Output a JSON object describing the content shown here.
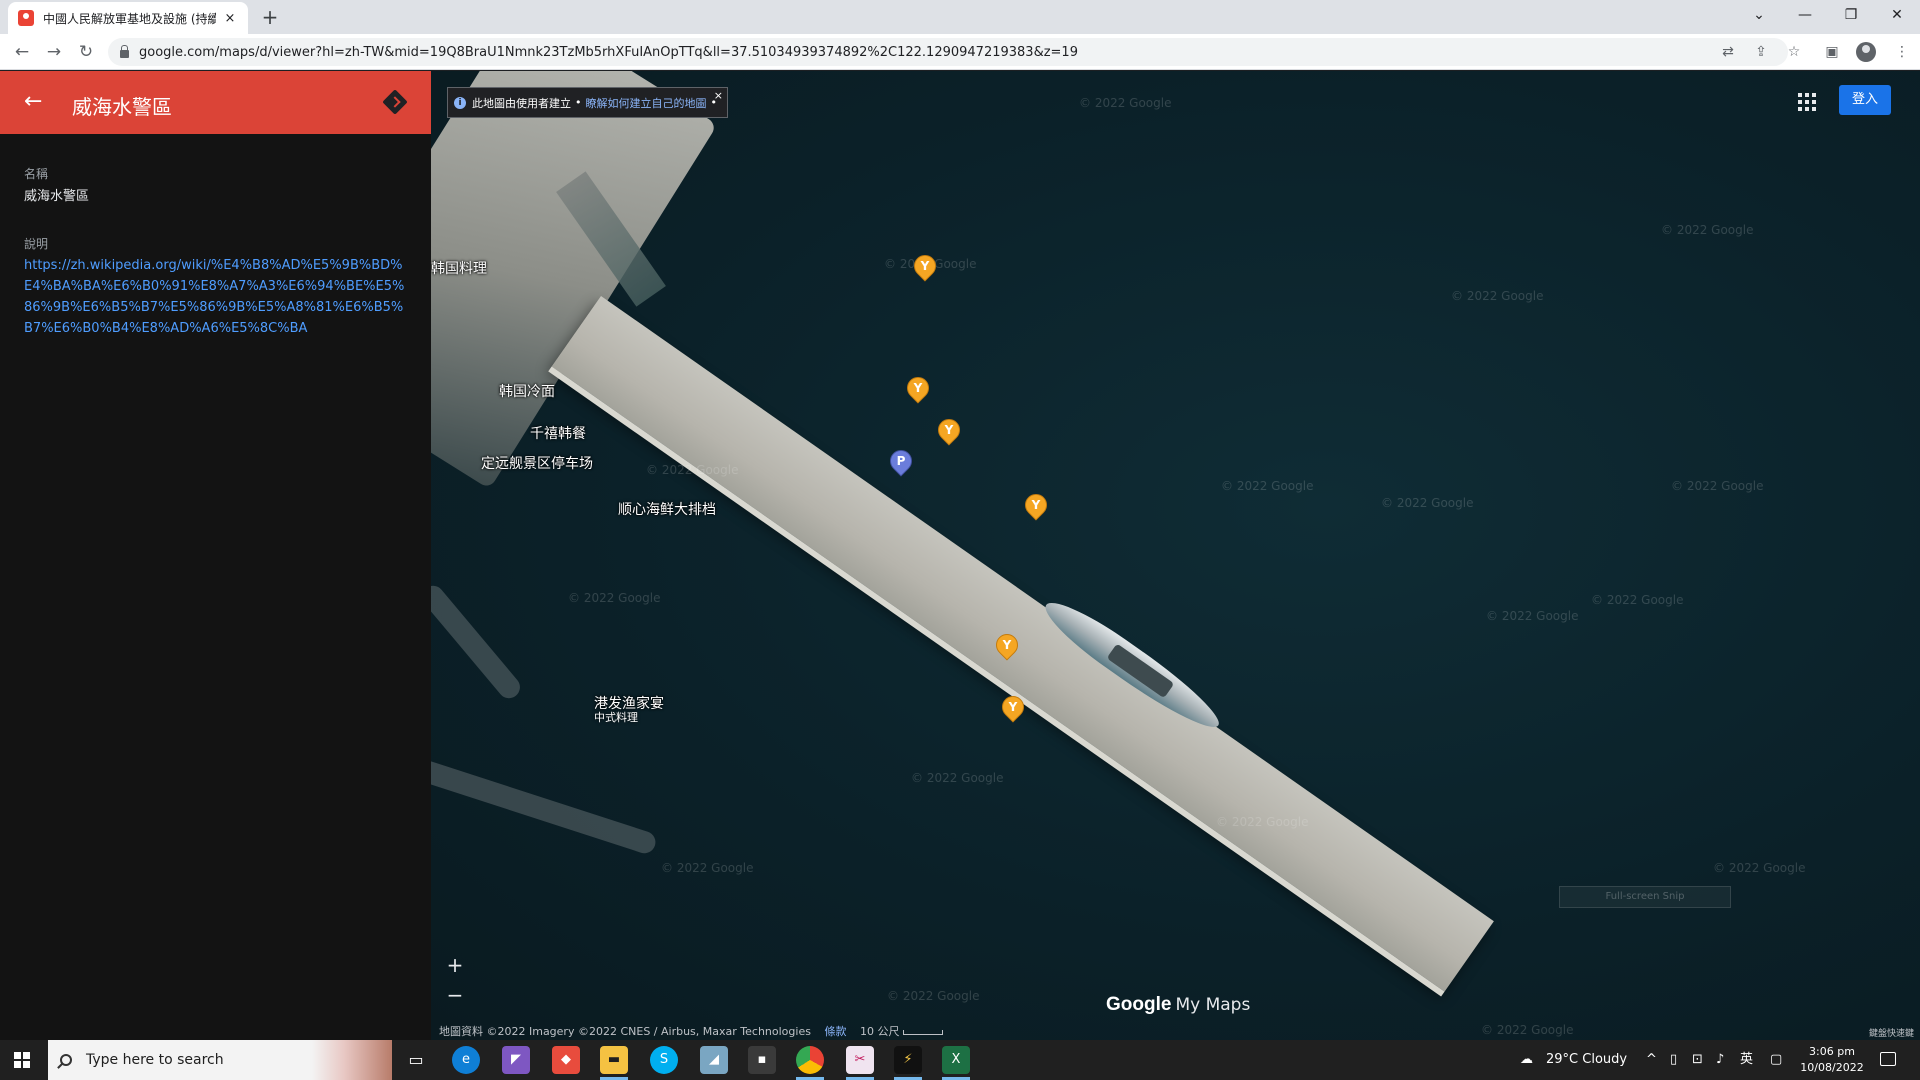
{
  "browser": {
    "tab_title": "中國人民解放軍基地及設施 (持續",
    "tab_close": "×",
    "new_tab": "+",
    "url": "google.com/maps/d/viewer?hl=zh-TW&mid=19Q8BraU1Nmnk23TzMb5rhXFuIAnOpTTq&ll=37.51034939374892%2C122.1290947219383&z=19"
  },
  "panel": {
    "title": "威海水警區",
    "name_label": "名稱",
    "name_value": "威海水警區",
    "desc_label": "說明",
    "desc_link": "https://zh.wikipedia.org/wiki/%E4%B8%AD%E5%9B%BD%E4%BA%BA%E6%B0%91%E8%A7%A3%E6%94%BE%E5%86%9B%E6%B5%B7%E5%86%9B%E5%A8%81%E6%B5%B7%E6%B0%B4%E8%AD%A6%E5%8C%BA"
  },
  "map": {
    "notice_text": "此地圖由使用者建立",
    "notice_link": "瞭解如何建立自己的地圖",
    "notice_sep": "•",
    "notice_close": "×",
    "signin": "登入",
    "zoom_in": "+",
    "zoom_out": "−",
    "logo_google": "Google",
    "logo_mymaps": "My Maps",
    "attribution": "地圖資料 ©2022 Imagery ©2022 CNES / Airbus, Maxar Technologies",
    "terms": "條款",
    "scale": "10 公尺",
    "shortcuts": "鍵盤快速鍵",
    "fullscreen_hint": "Full-screen Snip",
    "watermark": "© 2022 Google",
    "places": [
      {
        "label": "韩国料理",
        "type": "food"
      },
      {
        "label": "韩国冷面",
        "type": "food"
      },
      {
        "label": "千禧韩餐",
        "type": "food"
      },
      {
        "label": "定远舰景区停车场",
        "type": "parking"
      },
      {
        "label": "顺心海鲜大排档",
        "type": "food"
      },
      {
        "label": "",
        "type": "food"
      },
      {
        "label": "港发渔家宴",
        "sublabel": "中式料理",
        "type": "food"
      }
    ]
  },
  "taskbar": {
    "search_placeholder": "Type here to search",
    "weather": "29°C  Cloudy",
    "ime": "英",
    "time": "3:06 pm",
    "date": "10/08/2022"
  },
  "colors": {
    "panel_header": "#db4437",
    "link": "#4f9dff",
    "signin": "#1a73e8"
  }
}
